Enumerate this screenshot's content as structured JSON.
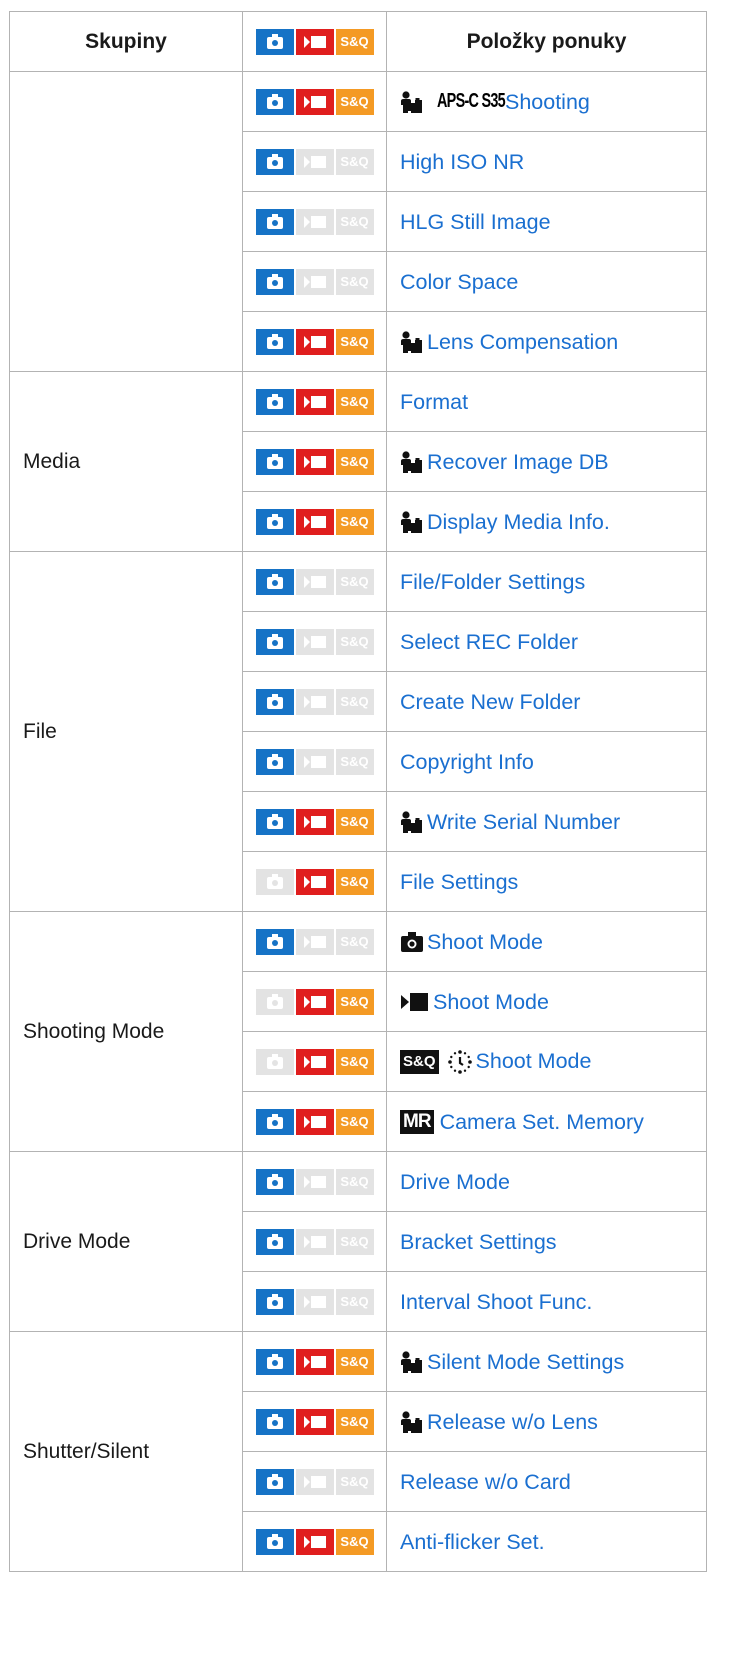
{
  "header": {
    "groups": "Skupiny",
    "items": "Položky ponuky"
  },
  "colors": {
    "photo": "#1673c6",
    "movie": "#e01e1e",
    "snq": "#f49a24",
    "disabled": "#e3e3e3",
    "link": "#1a6fd0"
  },
  "snq_label": "S&Q",
  "groups": [
    {
      "name": "",
      "rows": [
        {
          "modes": [
            true,
            true,
            true
          ],
          "icons": [
            "shooting-person-icon",
            "aps-c-s35-icon"
          ],
          "aps_label": "APS-C S35",
          "label": "Shooting"
        },
        {
          "modes": [
            true,
            false,
            false
          ],
          "icons": [],
          "label": "High ISO NR"
        },
        {
          "modes": [
            true,
            false,
            false
          ],
          "icons": [],
          "label": "HLG Still Image"
        },
        {
          "modes": [
            true,
            false,
            false
          ],
          "icons": [],
          "label": "Color Space"
        },
        {
          "modes": [
            true,
            true,
            true
          ],
          "icons": [
            "shooting-person-icon"
          ],
          "label": "Lens Compensation"
        }
      ]
    },
    {
      "name": "Media",
      "rows": [
        {
          "modes": [
            true,
            true,
            true
          ],
          "icons": [],
          "label": "Format"
        },
        {
          "modes": [
            true,
            true,
            true
          ],
          "icons": [
            "shooting-person-icon"
          ],
          "label": "Recover Image DB"
        },
        {
          "modes": [
            true,
            true,
            true
          ],
          "icons": [
            "shooting-person-icon"
          ],
          "label": "Display Media Info."
        }
      ]
    },
    {
      "name": "File",
      "rows": [
        {
          "modes": [
            true,
            false,
            false
          ],
          "icons": [],
          "label": "File/Folder Settings"
        },
        {
          "modes": [
            true,
            false,
            false
          ],
          "icons": [],
          "label": "Select REC Folder"
        },
        {
          "modes": [
            true,
            false,
            false
          ],
          "icons": [],
          "label": "Create New Folder"
        },
        {
          "modes": [
            true,
            false,
            false
          ],
          "icons": [],
          "label": "Copyright Info"
        },
        {
          "modes": [
            true,
            true,
            true
          ],
          "icons": [
            "shooting-person-icon"
          ],
          "label": "Write Serial Number"
        },
        {
          "modes": [
            false,
            true,
            true
          ],
          "icons": [],
          "label": "File Settings"
        }
      ]
    },
    {
      "name": "Shooting Mode",
      "rows": [
        {
          "modes": [
            true,
            false,
            false
          ],
          "icons": [
            "camera-icon"
          ],
          "label": "Shoot Mode"
        },
        {
          "modes": [
            false,
            true,
            true
          ],
          "icons": [
            "movie-icon"
          ],
          "label": "Shoot Mode"
        },
        {
          "modes": [
            false,
            true,
            true
          ],
          "icons": [
            "snq-icon",
            "slow-quick-dial-icon"
          ],
          "snq_icon_label": "S&Q",
          "label": "Shoot Mode"
        },
        {
          "modes": [
            true,
            true,
            true
          ],
          "icons": [
            "mr-icon"
          ],
          "mr_label": "MR",
          "label": "Camera Set. Memory"
        }
      ]
    },
    {
      "name": "Drive Mode",
      "rows": [
        {
          "modes": [
            true,
            false,
            false
          ],
          "icons": [],
          "label": "Drive Mode"
        },
        {
          "modes": [
            true,
            false,
            false
          ],
          "icons": [],
          "label": "Bracket Settings"
        },
        {
          "modes": [
            true,
            false,
            false
          ],
          "icons": [],
          "label": "Interval Shoot Func."
        }
      ]
    },
    {
      "name": "Shutter/Silent",
      "rows": [
        {
          "modes": [
            true,
            true,
            true
          ],
          "icons": [
            "shooting-person-icon"
          ],
          "label": "Silent Mode Settings"
        },
        {
          "modes": [
            true,
            true,
            true
          ],
          "icons": [
            "shooting-person-icon"
          ],
          "label": "Release w/o Lens"
        },
        {
          "modes": [
            true,
            false,
            false
          ],
          "icons": [],
          "label": "Release w/o Card"
        },
        {
          "modes": [
            true,
            true,
            true
          ],
          "icons": [],
          "label": "Anti-flicker Set."
        }
      ]
    }
  ]
}
